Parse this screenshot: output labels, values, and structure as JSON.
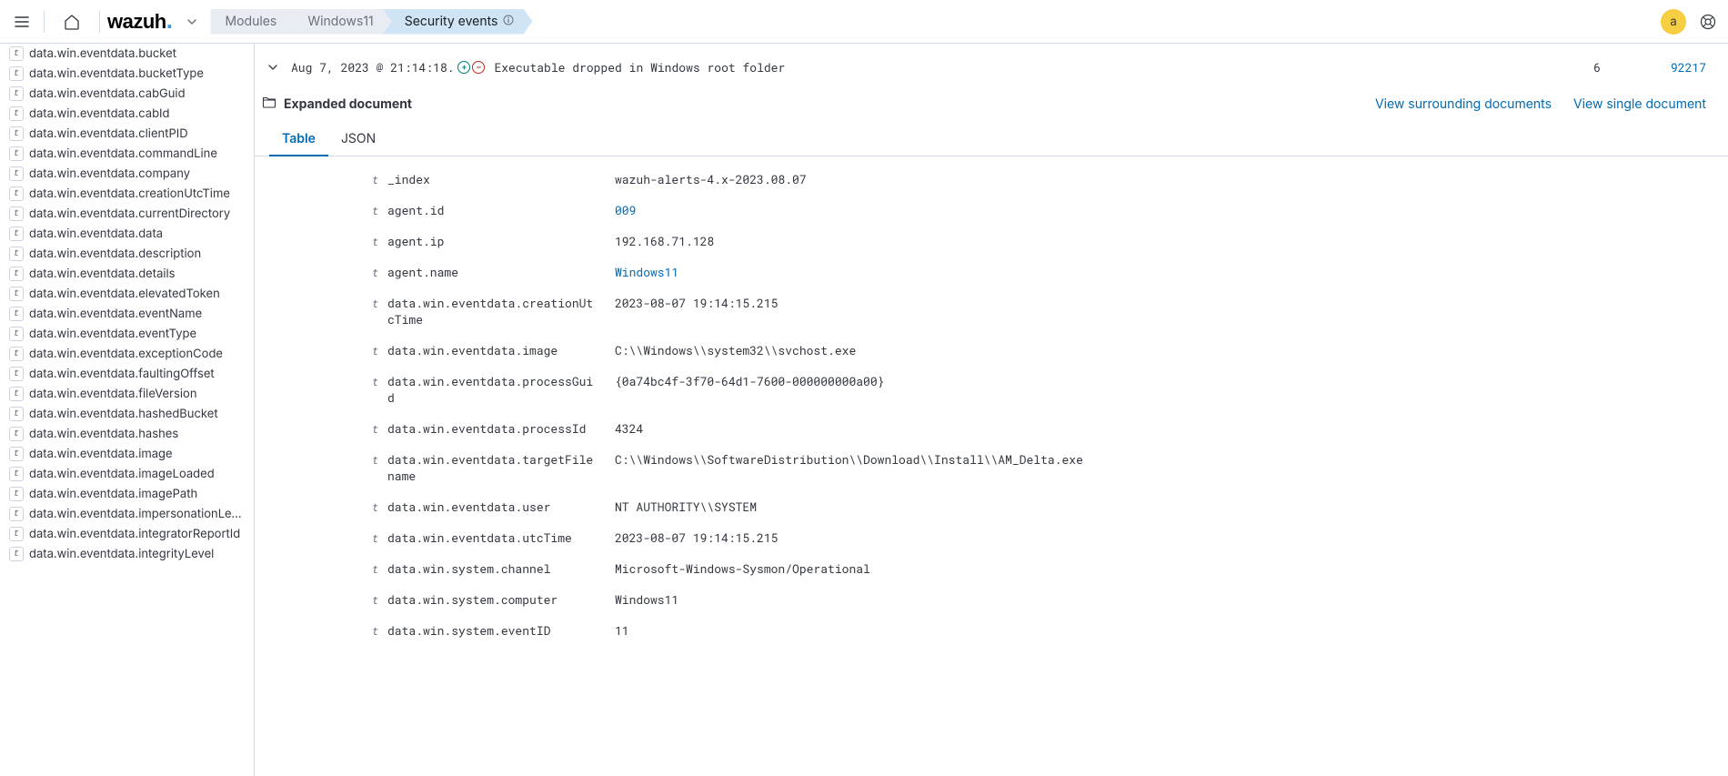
{
  "header": {
    "logo_text": "wazuh",
    "breadcrumbs": [
      {
        "label": "Modules",
        "active": false
      },
      {
        "label": "Windows11",
        "active": false
      },
      {
        "label": "Security events",
        "active": true,
        "info": true
      }
    ],
    "avatar_letter": "a"
  },
  "sidebar_fields": [
    "data.win.eventdata.bucket",
    "data.win.eventdata.bucketType",
    "data.win.eventdata.cabGuid",
    "data.win.eventdata.cabId",
    "data.win.eventdata.clientPID",
    "data.win.eventdata.commandLine",
    "data.win.eventdata.company",
    "data.win.eventdata.creationUtcTime",
    "data.win.eventdata.currentDirectory",
    "data.win.eventdata.data",
    "data.win.eventdata.description",
    "data.win.eventdata.details",
    "data.win.eventdata.elevatedToken",
    "data.win.eventdata.eventName",
    "data.win.eventdata.eventType",
    "data.win.eventdata.exceptionCode",
    "data.win.eventdata.faultingOffset",
    "data.win.eventdata.fileVersion",
    "data.win.eventdata.hashedBucket",
    "data.win.eventdata.hashes",
    "data.win.eventdata.image",
    "data.win.eventdata.imageLoaded",
    "data.win.eventdata.imagePath",
    "data.win.eventdata.impersonationLevel",
    "data.win.eventdata.integratorReportId",
    "data.win.eventdata.integrityLevel"
  ],
  "event": {
    "time": "Aug 7, 2023 @ 21:14:18.",
    "description": "Executable dropped in Windows root folder",
    "col1": "6",
    "col2": "92217"
  },
  "expanded": {
    "title": "Expanded document",
    "link_surrounding": "View surrounding documents",
    "link_single": "View single document"
  },
  "doc_tabs": [
    {
      "label": "Table",
      "active": true
    },
    {
      "label": "JSON",
      "active": false
    }
  ],
  "details": [
    {
      "key": "_index",
      "value": "wazuh-alerts-4.x-2023.08.07",
      "link": false
    },
    {
      "key": "agent.id",
      "value": "009",
      "link": true
    },
    {
      "key": "agent.ip",
      "value": "192.168.71.128",
      "link": false
    },
    {
      "key": "agent.name",
      "value": "Windows11",
      "link": true
    },
    {
      "key": "data.win.eventdata.creationUtcTime",
      "value": "2023-08-07 19:14:15.215",
      "link": false
    },
    {
      "key": "data.win.eventdata.image",
      "value": "C:\\\\Windows\\\\system32\\\\svchost.exe",
      "link": false
    },
    {
      "key": "data.win.eventdata.processGuid",
      "value": "{0a74bc4f-3f70-64d1-7600-000000000a00}",
      "link": false
    },
    {
      "key": "data.win.eventdata.processId",
      "value": "4324",
      "link": false
    },
    {
      "key": "data.win.eventdata.targetFilename",
      "value": "C:\\\\Windows\\\\SoftwareDistribution\\\\Download\\\\Install\\\\AM_Delta.exe",
      "link": false
    },
    {
      "key": "data.win.eventdata.user",
      "value": "NT AUTHORITY\\\\SYSTEM",
      "link": false
    },
    {
      "key": "data.win.eventdata.utcTime",
      "value": "2023-08-07 19:14:15.215",
      "link": false
    },
    {
      "key": "data.win.system.channel",
      "value": "Microsoft-Windows-Sysmon/Operational",
      "link": false
    },
    {
      "key": "data.win.system.computer",
      "value": "Windows11",
      "link": false
    },
    {
      "key": "data.win.system.eventID",
      "value": "11",
      "link": false
    }
  ],
  "type_label": "t"
}
